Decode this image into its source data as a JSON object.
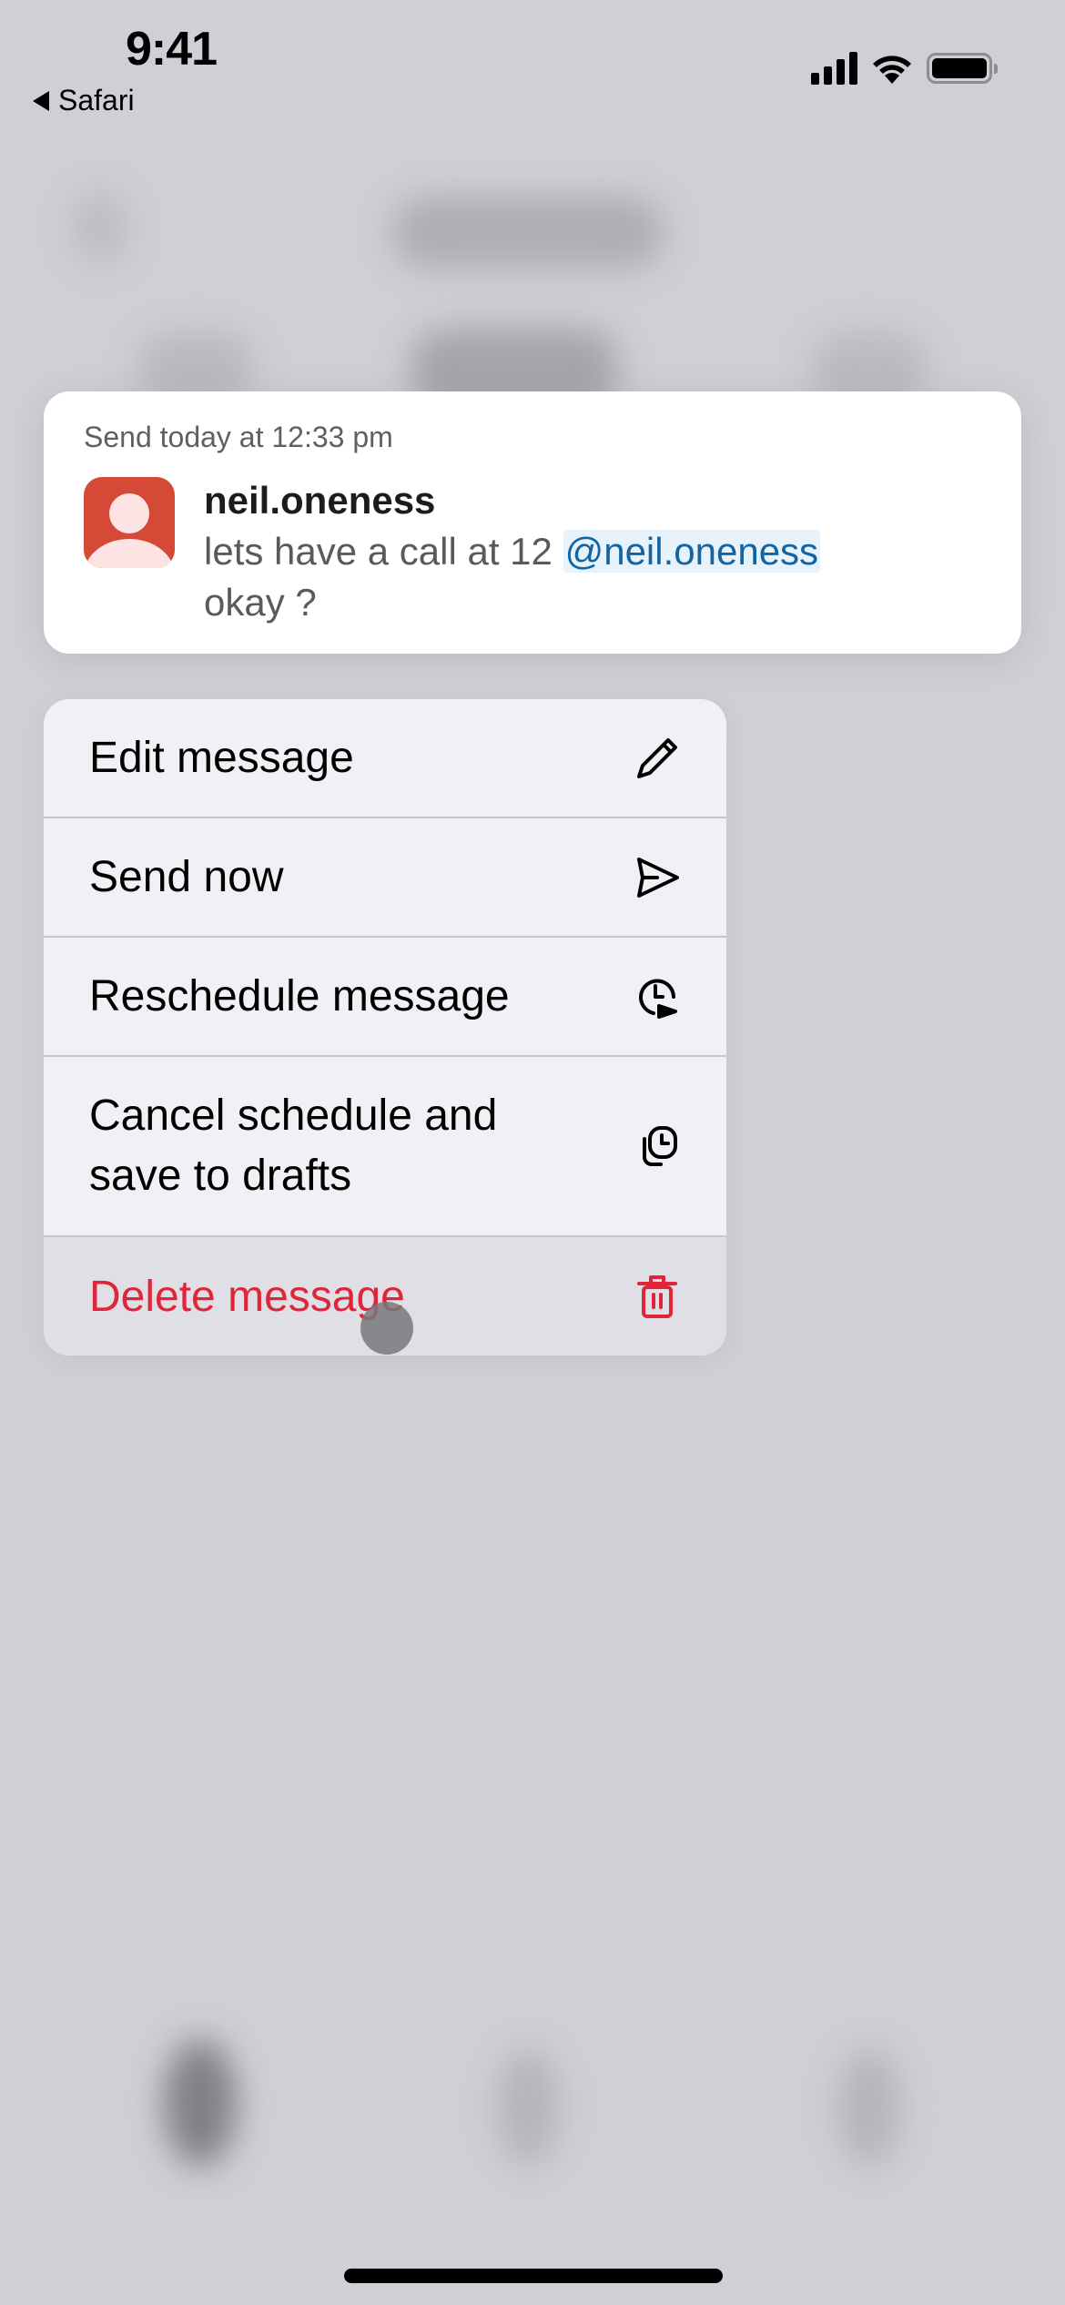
{
  "status_bar": {
    "time": "9:41",
    "back_app": "Safari",
    "icons": [
      "cellular-signal-icon",
      "wifi-icon",
      "battery-icon"
    ]
  },
  "message_preview": {
    "schedule_label": "Send today at 12:33 pm",
    "sender": "neil.oneness",
    "text_before_mention": "lets have a call at 12 ",
    "mention": "@neil.oneness",
    "text_after_mention": "okay ?",
    "avatar_color": "#d54a37",
    "mention_color": "#1264a3"
  },
  "context_menu": {
    "items": [
      {
        "label": "Edit message",
        "icon": "pencil-icon"
      },
      {
        "label": "Send now",
        "icon": "send-icon"
      },
      {
        "label": "Reschedule message",
        "icon": "clock-reschedule-icon"
      },
      {
        "label": "Cancel schedule and save to drafts",
        "icon": "drafts-clock-icon"
      },
      {
        "label": "Delete message",
        "icon": "trash-icon",
        "destructive": true,
        "color": "#e0243a"
      }
    ]
  }
}
